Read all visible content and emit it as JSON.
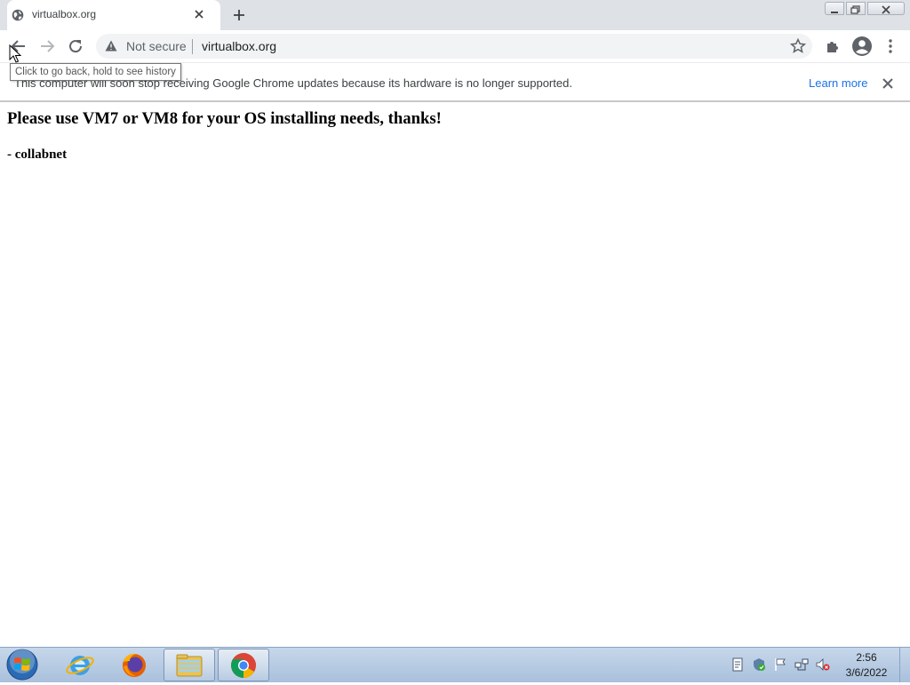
{
  "browser": {
    "tab": {
      "title": "virtualbox.org",
      "favicon": "globe-icon"
    },
    "omnibox": {
      "security_label": "Not secure",
      "url": "virtualbox.org"
    },
    "tooltip": "Click to go back, hold to see history",
    "infobar": {
      "message": "This computer will soon stop receiving Google Chrome updates because its hardware is no longer supported.",
      "link_label": "Learn more"
    },
    "colors": {
      "tabstrip": "#dee1e6",
      "link": "#1a73e8",
      "omnibox": "#f1f3f4"
    }
  },
  "page": {
    "heading": "Please use VM7 or VM8 for your OS installing needs, thanks!",
    "signoff": "- collabnet"
  },
  "taskbar": {
    "pinned": [
      "internet-explorer-icon",
      "firefox-icon",
      "file-explorer-icon",
      "chrome-icon"
    ],
    "clock": {
      "time": "2:56",
      "date": "3/6/2022"
    }
  }
}
